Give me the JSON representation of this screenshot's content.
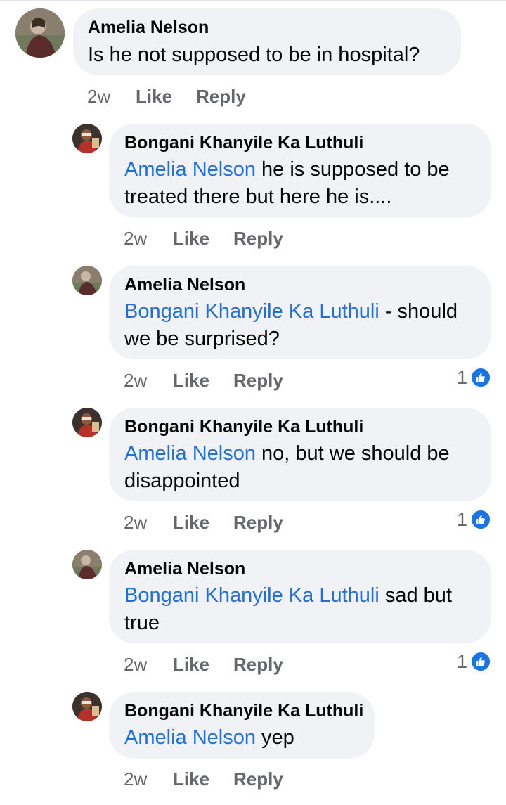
{
  "actions": {
    "like": "Like",
    "reply": "Reply"
  },
  "comments": [
    {
      "author": "Amelia Nelson",
      "mention": "",
      "text": "Is he not supposed to be in hospital?",
      "time": "2w",
      "reactions": "",
      "avatar_icon": "profile-photo-amelia"
    },
    {
      "author": "Bongani Khanyile Ka Luthuli",
      "mention": "Amelia Nelson",
      "text": " he is supposed to be treated there but here he is....",
      "time": "2w",
      "reactions": "",
      "avatar_icon": "profile-photo-bongani"
    },
    {
      "author": "Amelia Nelson",
      "mention": "Bongani Khanyile Ka Luthuli",
      "text": " - should we be surprised?",
      "time": "2w",
      "reactions": "1",
      "avatar_icon": "profile-photo-amelia"
    },
    {
      "author": "Bongani Khanyile Ka Luthuli",
      "mention": "Amelia Nelson",
      "text": " no, but we should be disappointed",
      "time": "2w",
      "reactions": "1",
      "avatar_icon": "profile-photo-bongani"
    },
    {
      "author": "Amelia Nelson",
      "mention": "Bongani Khanyile Ka Luthuli",
      "text": " sad but true",
      "time": "2w",
      "reactions": "1",
      "avatar_icon": "profile-photo-amelia"
    },
    {
      "author": "Bongani Khanyile Ka Luthuli",
      "mention": "Amelia Nelson",
      "text": " yep",
      "time": "2w",
      "reactions": "",
      "avatar_icon": "profile-photo-bongani"
    }
  ],
  "colors": {
    "mention": "#216fdb",
    "bubble": "#f0f2f5",
    "meta": "#65676b",
    "like_badge": "#1b74e4"
  }
}
